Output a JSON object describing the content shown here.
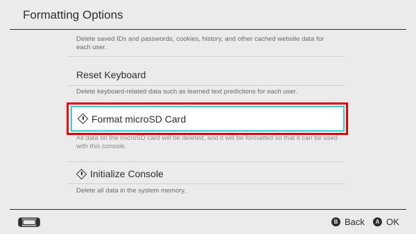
{
  "header": {
    "title": "Formatting Options"
  },
  "items": [
    {
      "desc": "Delete saved IDs and passwords, cookies, history, and other cached website data for each user."
    },
    {
      "label": "Reset Keyboard",
      "desc": "Delete keyboard-related data such as learned text predictions for each user."
    },
    {
      "label": "Format microSD Card",
      "desc": "All data on the microSD card will be deleted, and it will be formatted so that it can be used with this console."
    },
    {
      "label": "Initialize Console",
      "desc": "Delete all data in the system memory."
    }
  ],
  "footer": {
    "back": {
      "key": "B",
      "label": "Back"
    },
    "ok": {
      "key": "A",
      "label": "OK"
    }
  },
  "colors": {
    "background": "#ebebeb",
    "selection_border": "#3ccdc7",
    "highlight": "#e00000"
  }
}
